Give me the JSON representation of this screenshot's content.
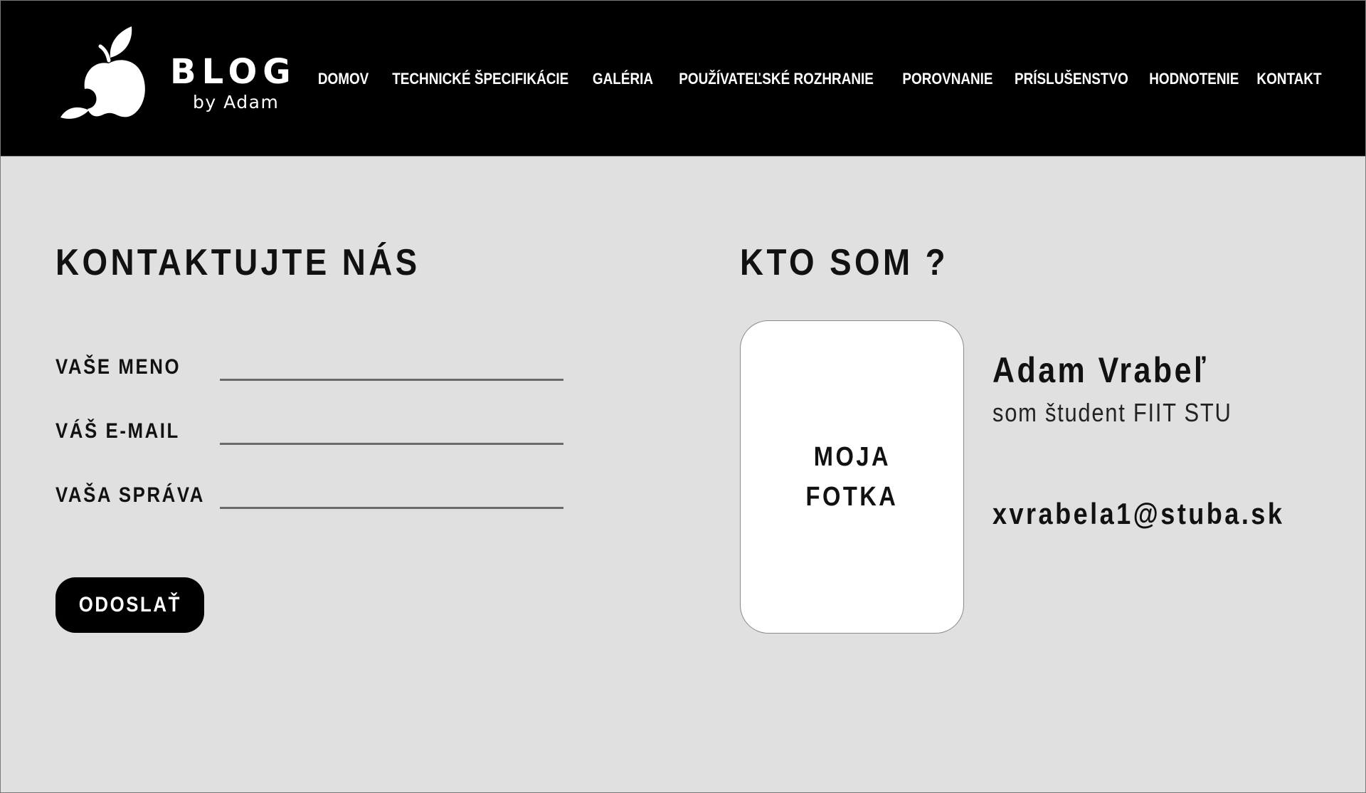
{
  "header": {
    "logo": {
      "icon": "apple-logo-icon",
      "title": "BLOG",
      "subtitle": "by Adam"
    },
    "nav": [
      {
        "label": "DOMOV"
      },
      {
        "label": "TECHNICKÉ ŠPECIFIKÁCIE"
      },
      {
        "label": "GALÉRIA"
      },
      {
        "label": "POUŽÍVATEĽSKÉ ROZHRANIE"
      },
      {
        "label": "POROVNANIE"
      },
      {
        "label": "PRÍSLUŠENSTVO"
      },
      {
        "label": "HODNOTENIE"
      },
      {
        "label": "KONTAKT"
      }
    ]
  },
  "contact": {
    "title": "KONTAKTUJTE NÁS",
    "fields": {
      "name": {
        "label": "VAŠE MENO",
        "value": ""
      },
      "email": {
        "label": "VÁŠ E-MAIL",
        "value": ""
      },
      "message": {
        "label": "VAŠA SPRÁVA",
        "value": ""
      }
    },
    "submit_label": "ODOSLAŤ"
  },
  "about": {
    "title": "KTO SOM ?",
    "photo_line1": "MOJA",
    "photo_line2": "FOTKA",
    "name": "Adam Vrabeľ",
    "subtitle": "som študent FIIT STU",
    "email": "xvrabela1@stuba.sk"
  },
  "colors": {
    "header_bg": "#000000",
    "page_bg": "#e0e0e0",
    "button_bg": "#000000",
    "text": "#111111"
  }
}
